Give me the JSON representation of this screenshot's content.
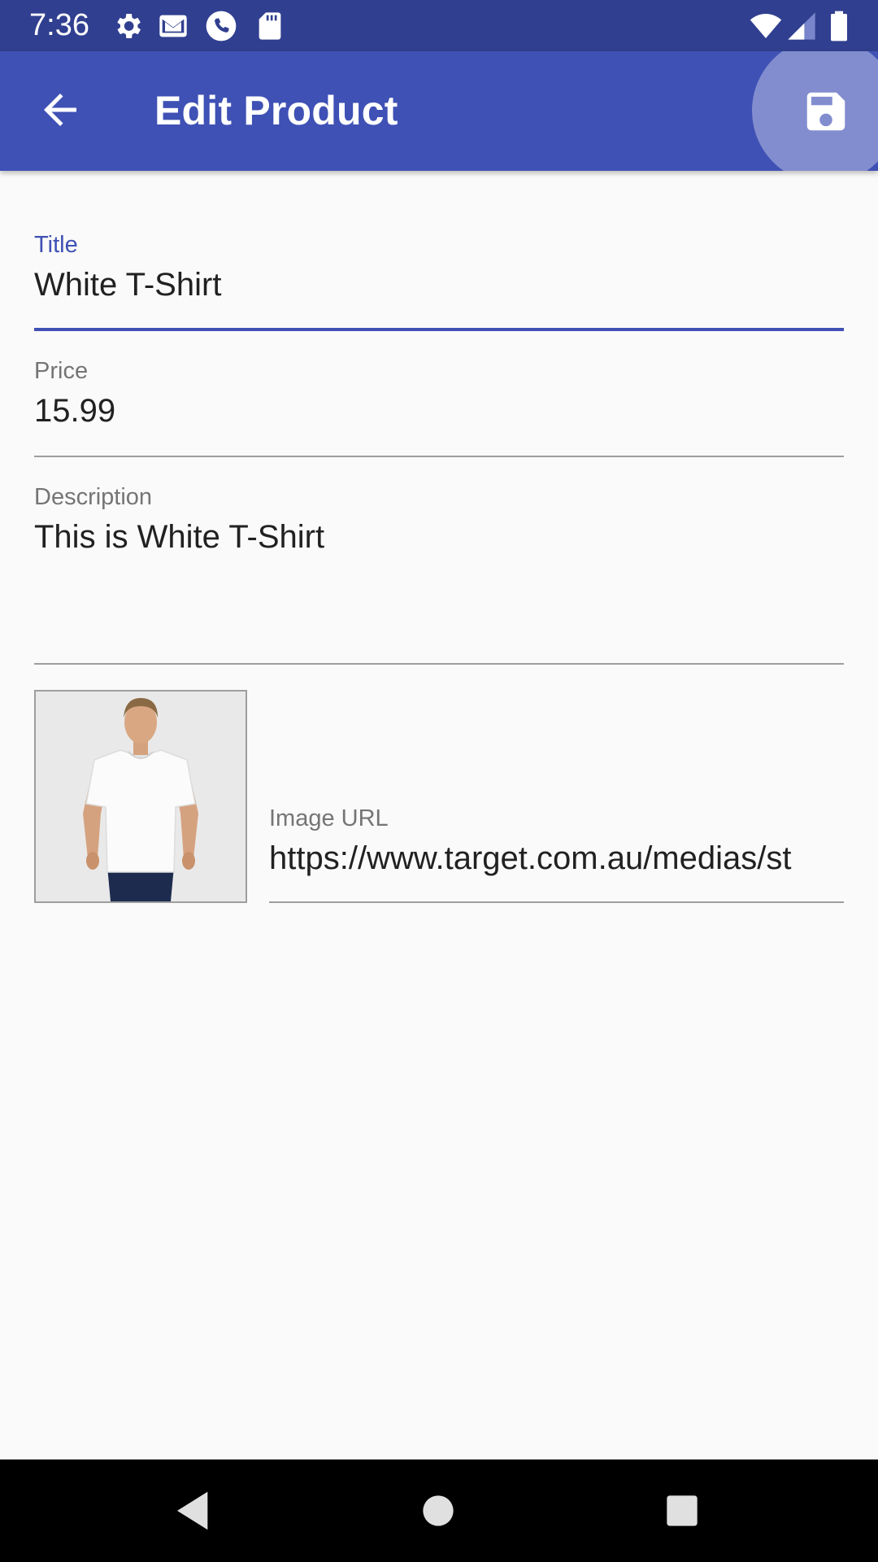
{
  "status_bar": {
    "time": "7:36",
    "left_icons": [
      "settings-icon",
      "gmail-icon",
      "phone-icon",
      "sd-card-icon"
    ],
    "right_icons": [
      "wifi-icon",
      "signal-icon",
      "battery-icon"
    ]
  },
  "app_bar": {
    "title": "Edit Product",
    "back_icon": "arrow-back-icon",
    "action_icon": "save-icon",
    "color": "#3f51b5"
  },
  "form": {
    "title": {
      "label": "Title",
      "value": "White T-Shirt"
    },
    "price": {
      "label": "Price",
      "value": "15.99"
    },
    "description": {
      "label": "Description",
      "value": "This is White T-Shirt"
    },
    "image_url": {
      "label": "Image URL",
      "value": "https://www.target.com.au/medias/st"
    }
  },
  "nav_bar": {
    "buttons": [
      "back-triangle-icon",
      "home-circle-icon",
      "recents-square-icon"
    ]
  }
}
